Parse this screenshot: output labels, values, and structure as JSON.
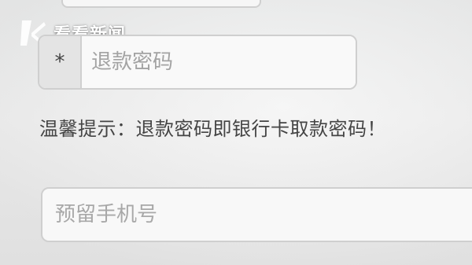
{
  "watermark": {
    "brand_text": "看看新闻",
    "icon": "kankan-logo-icon"
  },
  "refund_password": {
    "prefix_symbol": "*",
    "placeholder": "退款密码",
    "value": ""
  },
  "tip": {
    "text": "温馨提示：退款密码即银行卡取款密码！"
  },
  "phone": {
    "placeholder": "预留手机号",
    "value": ""
  }
}
